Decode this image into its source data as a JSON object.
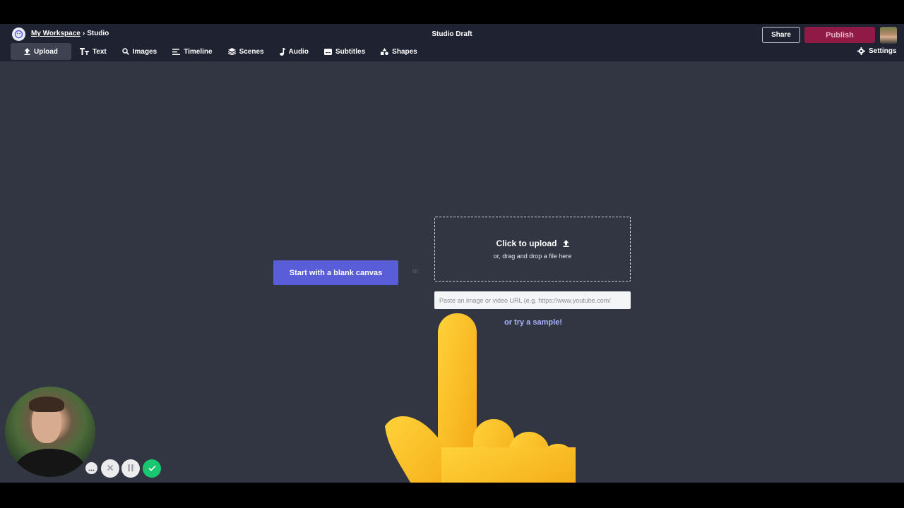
{
  "header": {
    "breadcrumb": {
      "workspace": "My Workspace",
      "separator": "›",
      "current": "Studio"
    },
    "title": "Studio Draft",
    "share_label": "Share",
    "publish_label": "Publish",
    "settings_label": "Settings"
  },
  "toolbar": {
    "items": [
      {
        "label": "Upload",
        "icon": "upload-icon"
      },
      {
        "label": "Text",
        "icon": "text-icon"
      },
      {
        "label": "Images",
        "icon": "search-icon"
      },
      {
        "label": "Timeline",
        "icon": "timeline-icon"
      },
      {
        "label": "Scenes",
        "icon": "layers-icon"
      },
      {
        "label": "Audio",
        "icon": "music-note-icon"
      },
      {
        "label": "Subtitles",
        "icon": "subtitles-icon"
      },
      {
        "label": "Shapes",
        "icon": "shapes-icon"
      }
    ]
  },
  "main": {
    "blank_canvas_label": "Start with a blank canvas",
    "or_label": "or",
    "upload_title": "Click to upload",
    "upload_subtitle": "or, drag and drop a file here",
    "url_placeholder": "Paste an image or video URL (e.g. https://www.youtube.com/",
    "sample_link": "or try a sample!"
  },
  "recorder": {
    "controls": [
      "more-icon",
      "cancel-icon",
      "pause-icon",
      "check-icon"
    ]
  },
  "colors": {
    "header_bg": "#1f2230",
    "canvas_bg": "#323642",
    "accent": "#5a5dd8",
    "publish": "#8f1a45",
    "link": "#a9b4ff",
    "record_done": "#18c76f"
  }
}
